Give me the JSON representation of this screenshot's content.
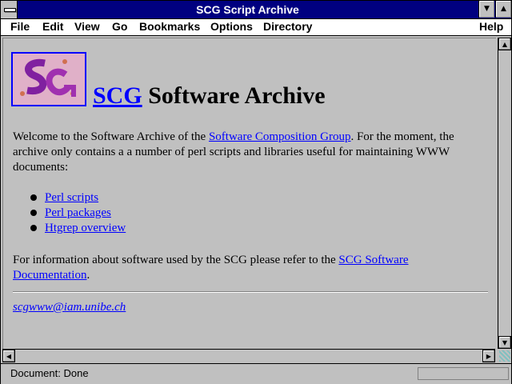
{
  "window": {
    "title": "SCG Script Archive"
  },
  "menu": {
    "file": "File",
    "edit": "Edit",
    "view": "View",
    "go": "Go",
    "bookmarks": "Bookmarks",
    "options": "Options",
    "directory": "Directory",
    "help": "Help"
  },
  "page": {
    "heading_link": "SCG",
    "heading_rest": " Software Archive",
    "intro_pre": "Welcome to the Software Archive of the ",
    "intro_link": "Software Composition Group",
    "intro_post": ". For the moment, the archive only contains a a number of perl scripts and libraries useful for maintaining WWW documents:",
    "links": [
      "Perl scripts",
      "Perl packages",
      "Htgrep overview"
    ],
    "info_pre": "For information about software used by the SCG please refer to the ",
    "info_link": "SCG Software Documentation",
    "info_post": ".",
    "email": "scgwww@iam.unibe.ch "
  },
  "status": {
    "text": "Document: Done"
  },
  "colors": {
    "titlebar": "#000080",
    "link": "#0000ff",
    "window_bg": "#c0c0c0"
  }
}
